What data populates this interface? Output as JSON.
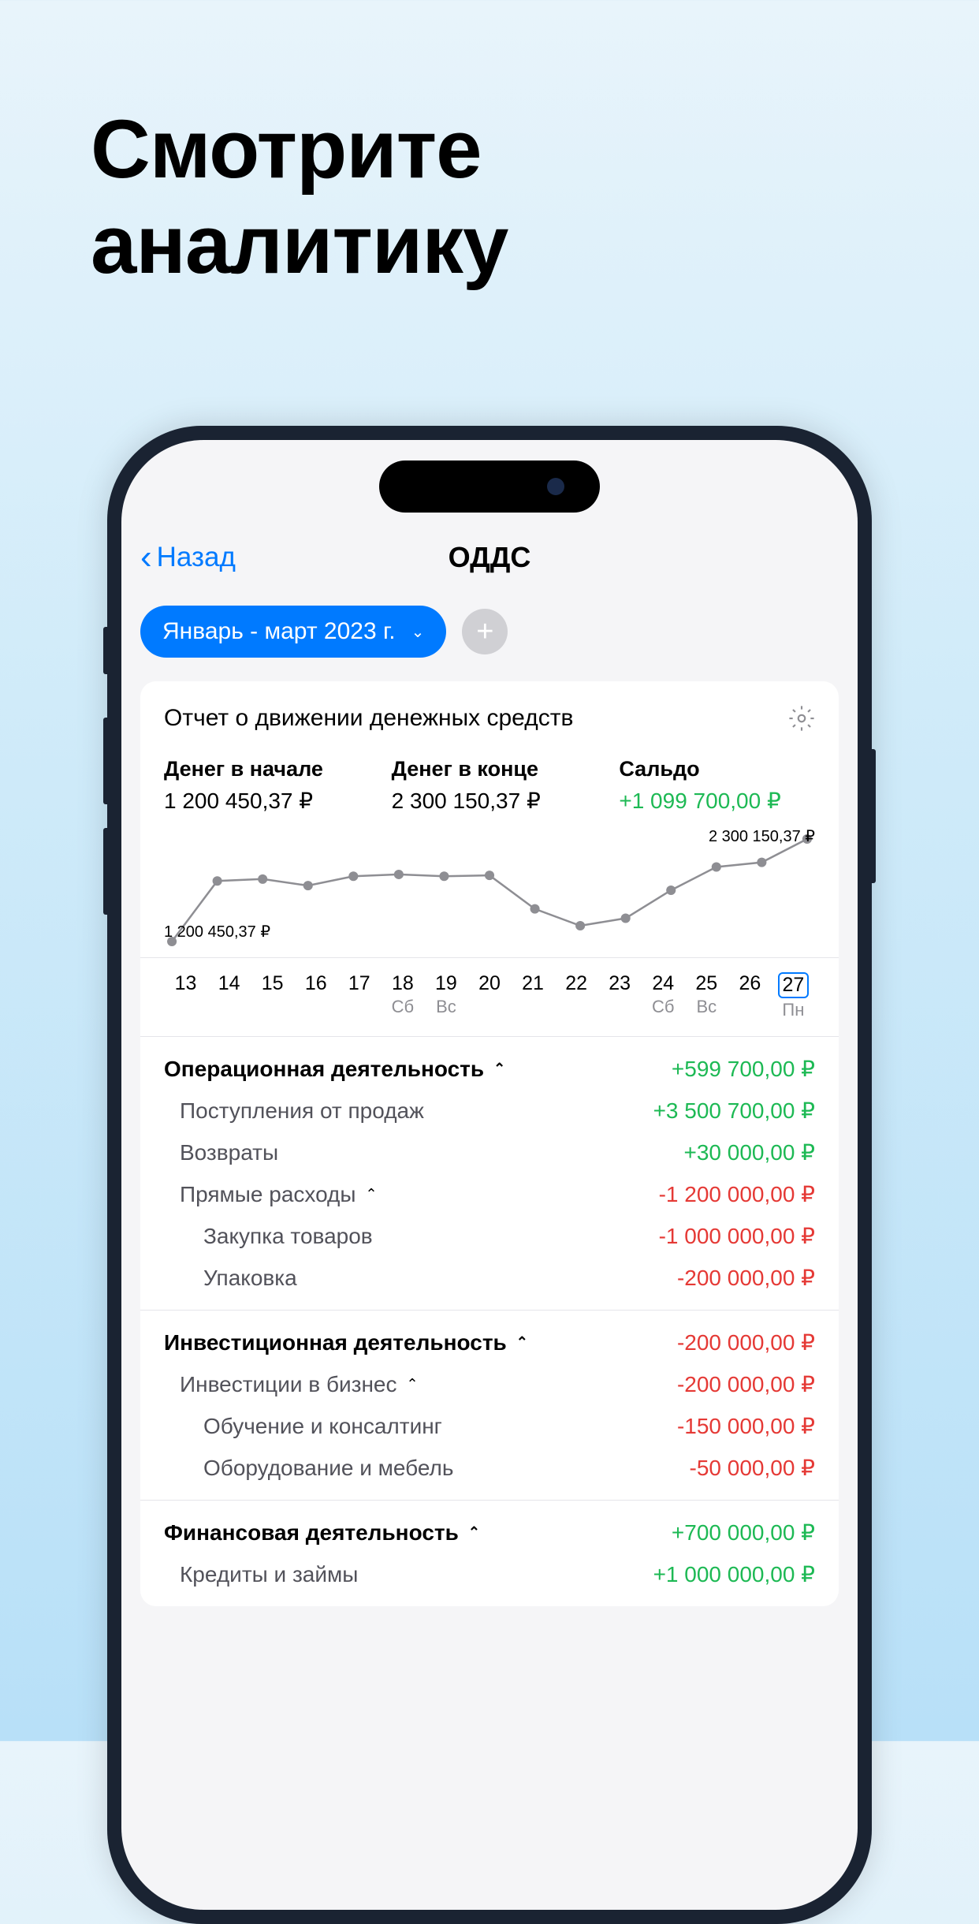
{
  "marketing": {
    "line1": "Смотрите",
    "line2": "аналитику"
  },
  "nav": {
    "back": "Назад",
    "title": "ОДДС"
  },
  "filters": {
    "period": "Январь - март 2023 г."
  },
  "card": {
    "title": "Отчет о движении денежных средств",
    "summary": {
      "start_label": "Денег в начале",
      "start_value": "1 200 450,37 ₽",
      "end_label": "Денег в конце",
      "end_value": "2 300 150,37 ₽",
      "saldo_label": "Сальдо",
      "saldo_value": "+1 099 700,00 ₽"
    },
    "chart_start": "1 200 450,37 ₽",
    "chart_end": "2 300 150,37 ₽"
  },
  "chart_data": {
    "type": "line",
    "title": "Отчет о движении денежных средств",
    "ylabel": "₽",
    "ylim": [
      1200450,
      2300150
    ],
    "x": [
      13,
      14,
      15,
      16,
      17,
      18,
      19,
      20,
      21,
      22,
      23,
      24,
      25,
      26,
      27
    ],
    "values": [
      1200450,
      1850000,
      1870000,
      1800000,
      1900000,
      1920000,
      1900000,
      1910000,
      1550000,
      1370000,
      1450000,
      1750000,
      2000000,
      2050000,
      2300150
    ],
    "day_labels": [
      "",
      "",
      "",
      "",
      "",
      "Сб",
      "Вс",
      "",
      "",
      "",
      "",
      "Сб",
      "Вс",
      "",
      "Пн"
    ],
    "selected_index": 14
  },
  "sections": {
    "op": {
      "title": "Операционная деятельность",
      "amount": "+599 700,00 ₽",
      "r0_label": "Поступления от продаж",
      "r0_amount": "+3 500 700,00 ₽",
      "r1_label": "Возвраты",
      "r1_amount": "+30 000,00 ₽",
      "r2_label": "Прямые расходы",
      "r2_amount": "-1 200 000,00 ₽",
      "r3_label": "Закупка товаров",
      "r3_amount": "-1 000 000,00 ₽",
      "r4_label": "Упаковка",
      "r4_amount": "-200 000,00 ₽"
    },
    "inv": {
      "title": "Инвестиционная деятельность",
      "amount": "-200 000,00 ₽",
      "r0_label": "Инвестиции в бизнес",
      "r0_amount": "-200 000,00 ₽",
      "r1_label": "Обучение и консалтинг",
      "r1_amount": "-150 000,00 ₽",
      "r2_label": "Оборудование и мебель",
      "r2_amount": "-50 000,00 ₽"
    },
    "fin": {
      "title": "Финансовая деятельность",
      "amount": "+700 000,00 ₽",
      "r0_label": "Кредиты и займы",
      "r0_amount": "+1 000 000,00 ₽"
    }
  }
}
